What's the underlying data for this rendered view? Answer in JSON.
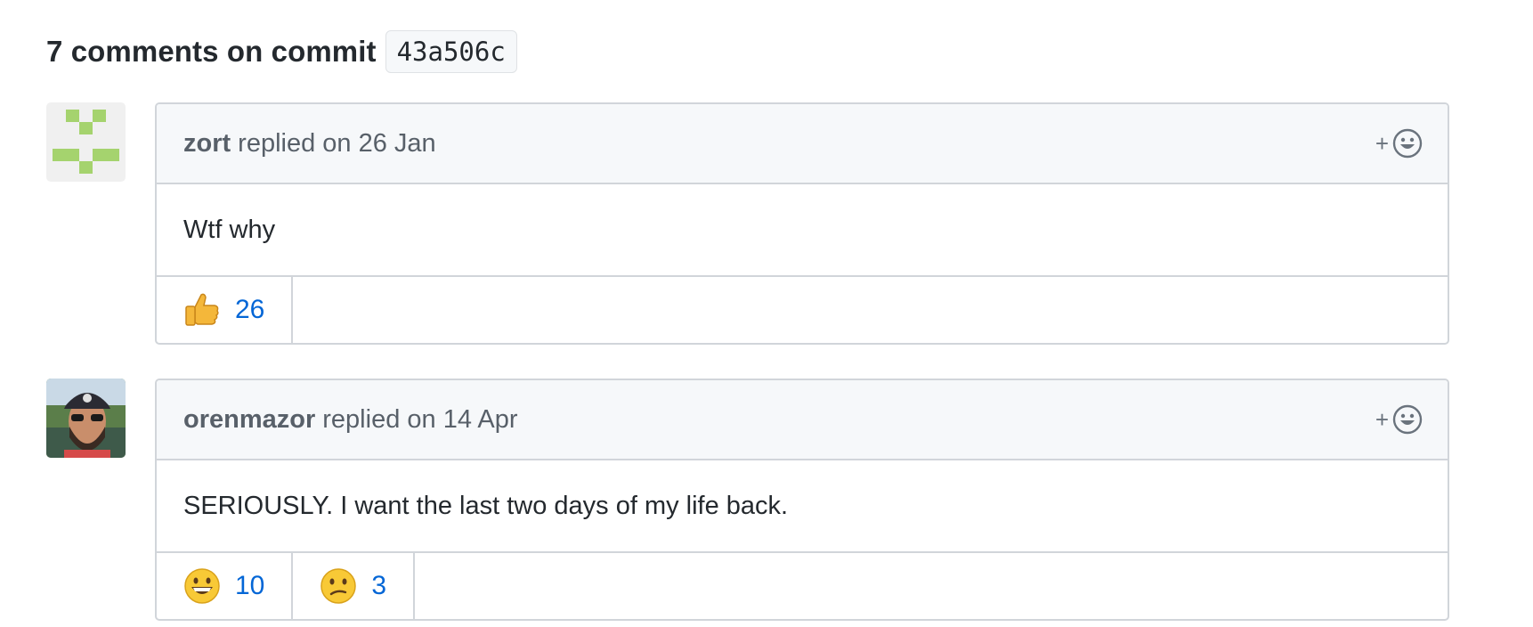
{
  "heading": {
    "title": "7 comments on commit",
    "commit_sha": "43a506c"
  },
  "comments": [
    {
      "author": "zort",
      "meta": "replied on 26 Jan",
      "body": "Wtf why",
      "avatar": "identicon-avatar",
      "reactions": [
        {
          "emoji": "thumbs-up",
          "count": "26"
        }
      ]
    },
    {
      "author": "orenmazor",
      "meta": "replied on 14 Apr",
      "body": "SERIOUSLY. I want the last two days of my life back.",
      "avatar": "photo-avatar",
      "reactions": [
        {
          "emoji": "grinning-face",
          "count": "10"
        },
        {
          "emoji": "confused-face",
          "count": "3"
        }
      ]
    }
  ],
  "add_reaction_plus": "+",
  "colors": {
    "link_blue": "#0366d6",
    "header_bg": "#f6f8fa",
    "border": "#d1d5da",
    "identicon_green": "#a5d36e"
  }
}
